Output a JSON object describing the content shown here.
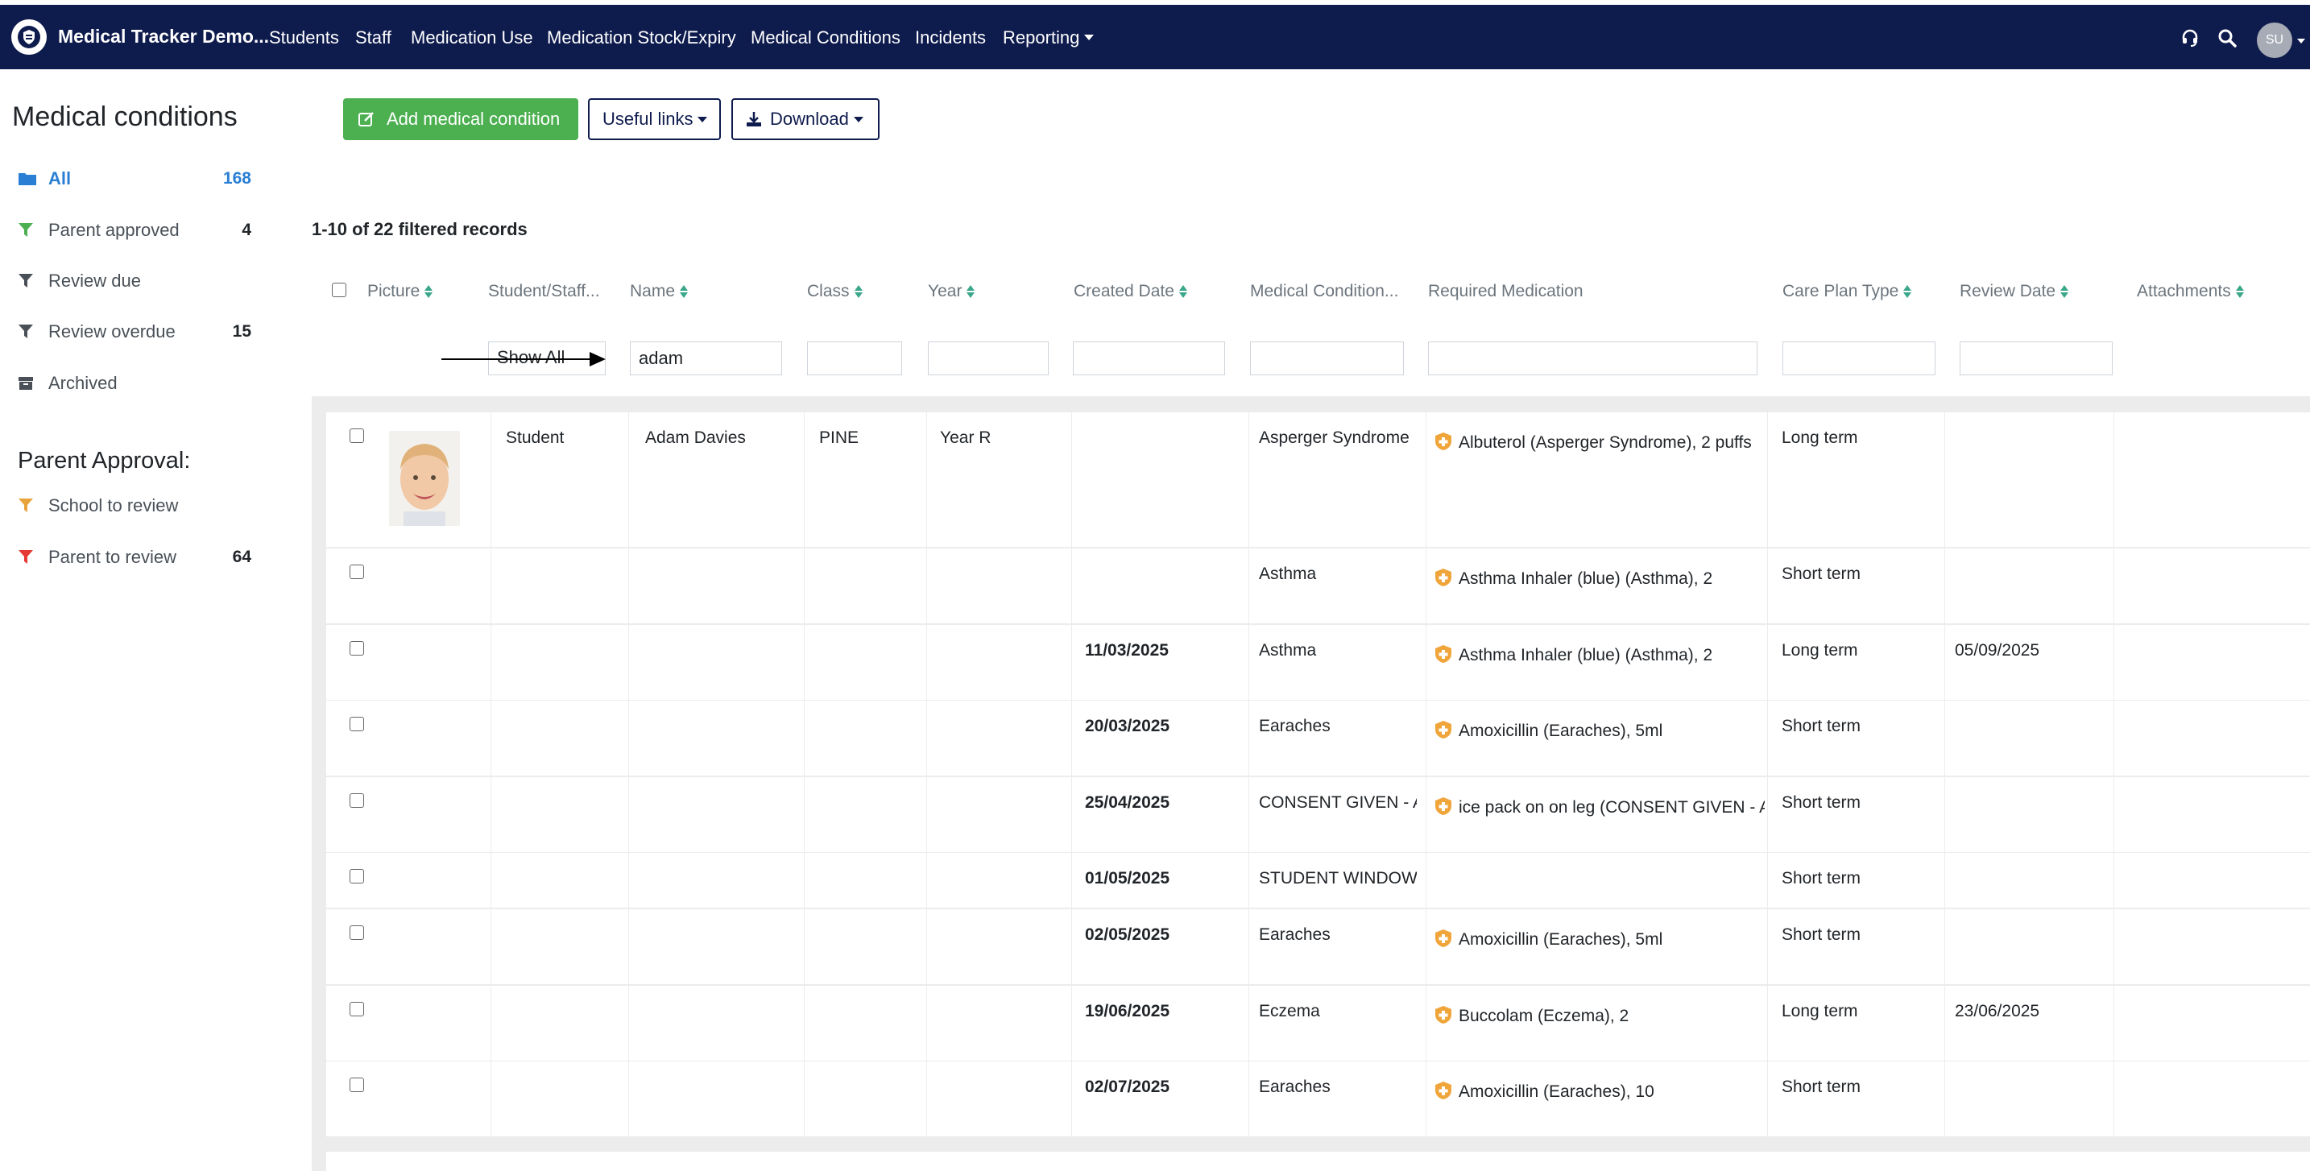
{
  "app": {
    "brand": "Medical Tracker Demo...",
    "nav": [
      "Students",
      "Staff",
      "Medication Use",
      "Medication Stock/Expiry",
      "Medical Conditions",
      "Incidents",
      "Reporting"
    ],
    "user_initials": "SU",
    "icons": [
      "headset-icon",
      "search-icon"
    ]
  },
  "sidebar": {
    "title": "Medical conditions",
    "items": [
      {
        "label": "All",
        "count": "168",
        "icon": "folder-icon",
        "color": "#2a7fd4"
      },
      {
        "label": "Parent approved",
        "count": "4",
        "icon": "filter-icon",
        "color": "#4caf50"
      },
      {
        "label": "Review due",
        "count": "",
        "icon": "filter-icon",
        "color": "#495057"
      },
      {
        "label": "Review overdue",
        "count": "15",
        "icon": "filter-icon",
        "color": "#495057"
      },
      {
        "label": "Archived",
        "count": "",
        "icon": "archive-icon",
        "color": "#495057"
      }
    ],
    "approval_title": "Parent Approval:",
    "approval_items": [
      {
        "label": "School to review",
        "count": "",
        "icon": "filter-icon",
        "color": "#e8a33c"
      },
      {
        "label": "Parent to review",
        "count": "64",
        "icon": "filter-icon",
        "color": "#e53935"
      }
    ]
  },
  "toolbar": {
    "add_label": "Add medical condition",
    "links_label": "Useful links",
    "download_label": "Download"
  },
  "table": {
    "records_text": "1-10 of 22 filtered records",
    "columns": [
      "Picture",
      "Student/Staff...",
      "Name",
      "Class",
      "Year",
      "Created Date",
      "Medical Condition...",
      "Required Medication",
      "Care Plan Type",
      "Review Date",
      "Attachments"
    ],
    "filters": {
      "student_staff": "Show All",
      "name": "adam"
    },
    "rows": [
      {
        "type": "Student",
        "name": "Adam Davies",
        "class": "PINE",
        "year": "Year R",
        "created": "",
        "condition": "Asperger Syndrome",
        "medication": "Albuterol (Asperger Syndrome), 2 puffs",
        "care_plan": "Long term",
        "review": ""
      },
      {
        "type": "",
        "name": "",
        "class": "",
        "year": "",
        "created": "",
        "condition": "Asthma",
        "medication": "Asthma Inhaler (blue) (Asthma), 2",
        "care_plan": "Short term",
        "review": ""
      },
      {
        "type": "",
        "name": "",
        "class": "",
        "year": "",
        "created": "11/03/2025",
        "condition": "Asthma",
        "medication": "Asthma Inhaler (blue) (Asthma), 2",
        "care_plan": "Long term",
        "review": "05/09/2025"
      },
      {
        "type": "",
        "name": "",
        "class": "",
        "year": "",
        "created": "20/03/2025",
        "condition": "Earaches",
        "medication": "Amoxicillin (Earaches), 5ml",
        "care_plan": "Short term",
        "review": ""
      },
      {
        "type": "",
        "name": "",
        "class": "",
        "year": "",
        "created": "25/04/2025",
        "condition": "CONSENT GIVEN - AS",
        "medication": "ice pack on on leg (CONSENT GIVEN - AS",
        "care_plan": "Short term",
        "review": ""
      },
      {
        "type": "",
        "name": "",
        "class": "",
        "year": "",
        "created": "01/05/2025",
        "condition": "STUDENT WINDOW \\",
        "medication": "",
        "care_plan": "Short term",
        "review": ""
      },
      {
        "type": "",
        "name": "",
        "class": "",
        "year": "",
        "created": "02/05/2025",
        "condition": "Earaches",
        "medication": "Amoxicillin (Earaches), 5ml",
        "care_plan": "Short term",
        "review": ""
      },
      {
        "type": "",
        "name": "",
        "class": "",
        "year": "",
        "created": "19/06/2025",
        "condition": "Eczema",
        "medication": "Buccolam (Eczema), 2",
        "care_plan": "Long term",
        "review": "23/06/2025"
      },
      {
        "type": "",
        "name": "",
        "class": "",
        "year": "",
        "created": "02/07/2025",
        "condition": "Earaches",
        "medication": "Amoxicillin (Earaches), 10",
        "care_plan": "Short term",
        "review": ""
      }
    ]
  },
  "colors": {
    "navbar": "#0e1b4d",
    "primary_green": "#4caf50",
    "sort_arrows": "#3aa68a",
    "medication_shield": "#f0a53a"
  }
}
